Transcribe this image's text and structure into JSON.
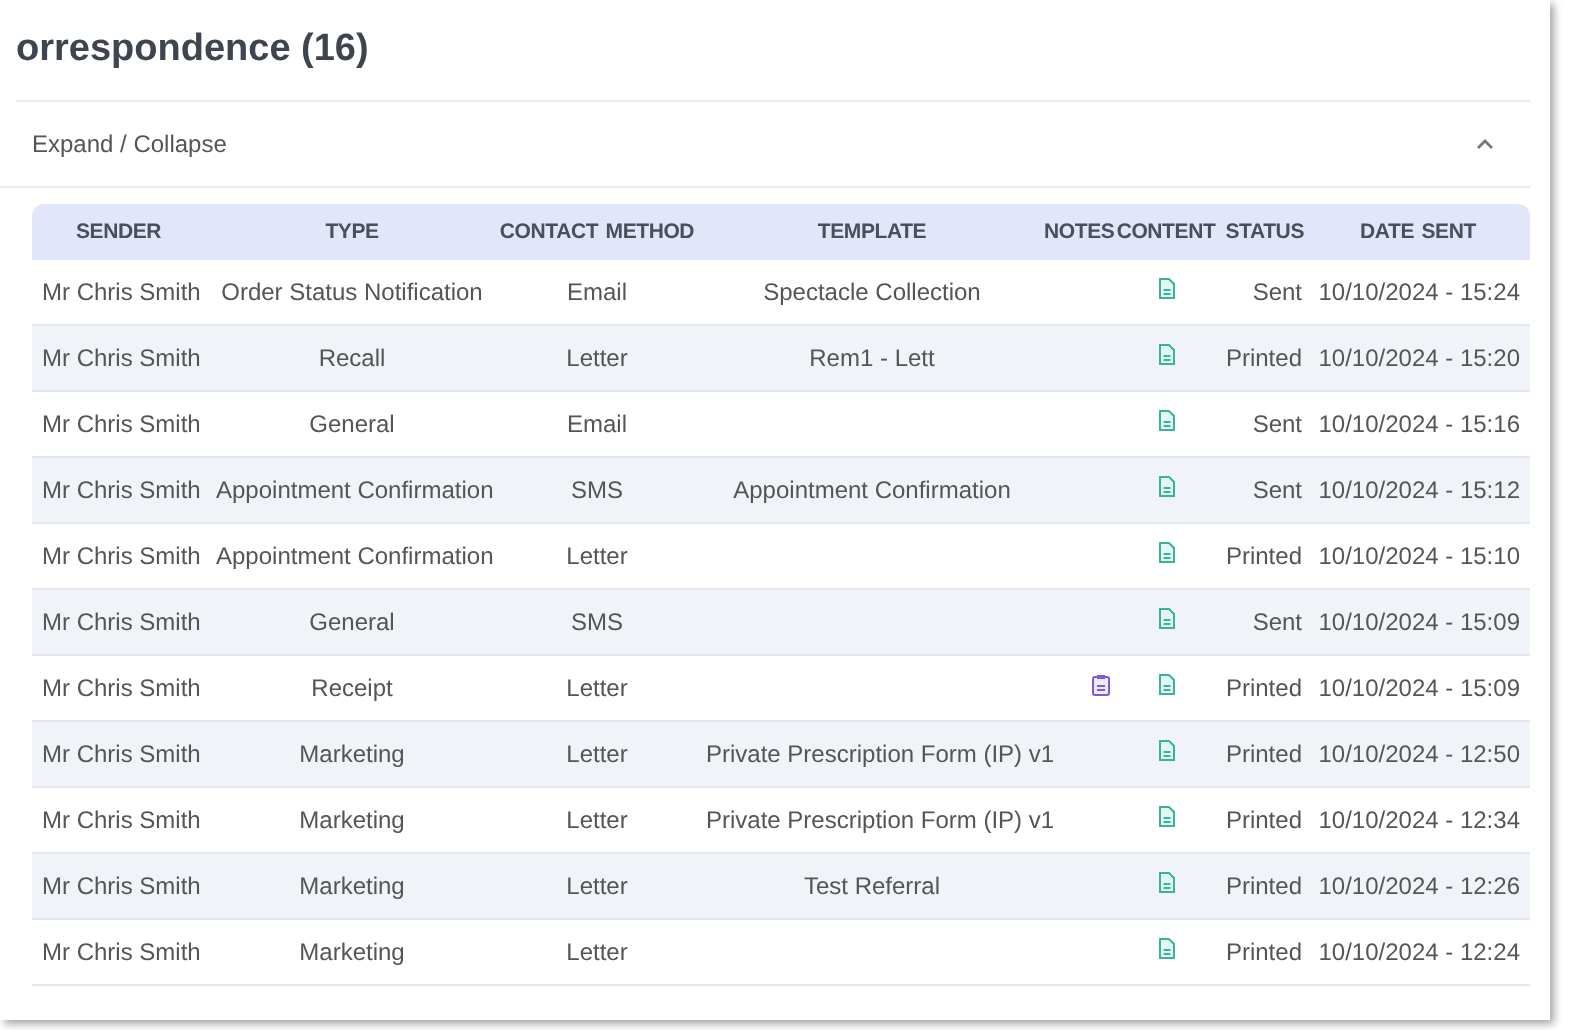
{
  "title": "orrespondence (16)",
  "panel": {
    "toggle_label": "Expand / Collapse",
    "expanded": true
  },
  "table": {
    "columns": [
      "SENDER",
      "TYPE",
      "CONTACT METHOD",
      "TEMPLATE",
      "NOTES",
      "CONTENT",
      "STATUS",
      "DATE SENT"
    ],
    "rows": [
      {
        "sender": "Mr Chris Smith",
        "type": "Order Status Notification",
        "contact_method": "Email",
        "template": "Spectacle Collection",
        "notes": false,
        "status": "Sent",
        "date_sent": "10/10/2024 - 15:24"
      },
      {
        "sender": "Mr Chris Smith",
        "type": "Recall",
        "contact_method": "Letter",
        "template": "Rem1 - Lett",
        "notes": false,
        "status": "Printed",
        "date_sent": "10/10/2024 - 15:20"
      },
      {
        "sender": "Mr Chris Smith",
        "type": "General",
        "contact_method": "Email",
        "template": "",
        "notes": false,
        "status": "Sent",
        "date_sent": "10/10/2024 - 15:16"
      },
      {
        "sender": "Mr Chris Smith",
        "type": "Appointment Confirmation",
        "contact_method": "SMS",
        "template": "Appointment Confirmation",
        "notes": false,
        "status": "Sent",
        "date_sent": "10/10/2024 - 15:12"
      },
      {
        "sender": "Mr Chris Smith",
        "type": "Appointment Confirmation",
        "contact_method": "Letter",
        "template": "",
        "notes": false,
        "status": "Printed",
        "date_sent": "10/10/2024 - 15:10"
      },
      {
        "sender": "Mr Chris Smith",
        "type": "General",
        "contact_method": "SMS",
        "template": "",
        "notes": false,
        "status": "Sent",
        "date_sent": "10/10/2024 - 15:09"
      },
      {
        "sender": "Mr Chris Smith",
        "type": "Receipt",
        "contact_method": "Letter",
        "template": "",
        "notes": true,
        "status": "Printed",
        "date_sent": "10/10/2024 - 15:09"
      },
      {
        "sender": "Mr Chris Smith",
        "type": "Marketing",
        "contact_method": "Letter",
        "template": "Private Prescription Form (IP) v1",
        "notes": false,
        "status": "Printed",
        "date_sent": "10/10/2024 - 12:50"
      },
      {
        "sender": "Mr Chris Smith",
        "type": "Marketing",
        "contact_method": "Letter",
        "template": "Private Prescription Form (IP) v1",
        "notes": false,
        "status": "Printed",
        "date_sent": "10/10/2024 - 12:34"
      },
      {
        "sender": "Mr Chris Smith",
        "type": "Marketing",
        "contact_method": "Letter",
        "template": "Test Referral",
        "notes": false,
        "status": "Printed",
        "date_sent": "10/10/2024 - 12:26"
      },
      {
        "sender": "Mr Chris Smith",
        "type": "Marketing",
        "contact_method": "Letter",
        "template": "",
        "notes": false,
        "status": "Printed",
        "date_sent": "10/10/2024 - 12:24"
      }
    ]
  }
}
